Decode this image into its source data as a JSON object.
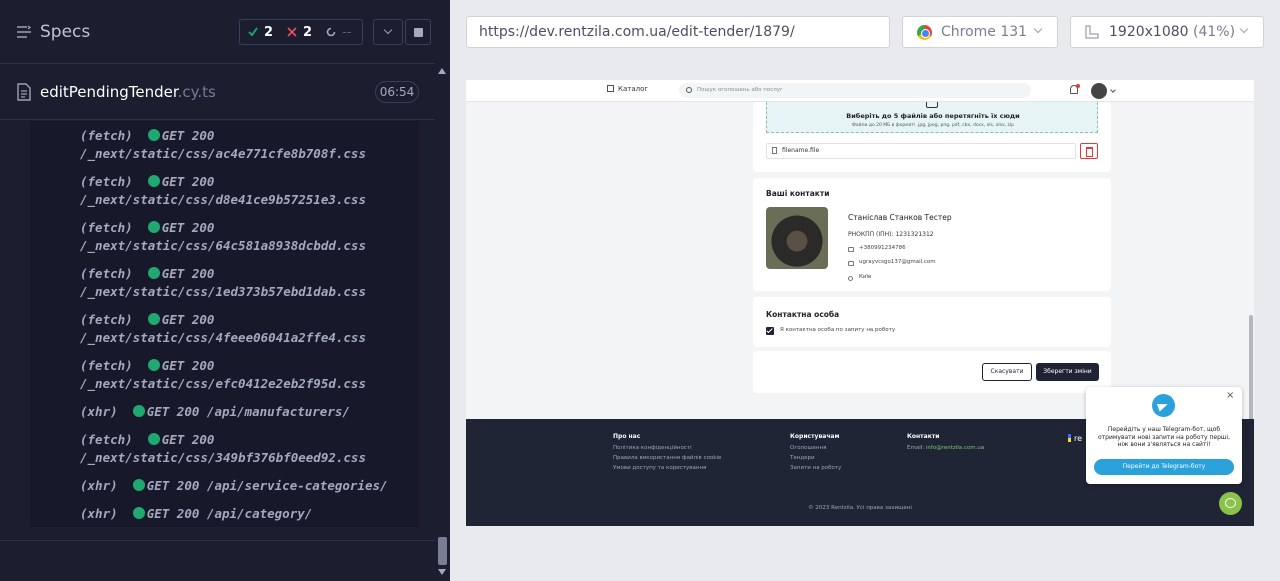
{
  "runner": {
    "title": "Specs",
    "passed": "2",
    "failed": "2",
    "pending": "--",
    "spec": {
      "name": "editPendingTender",
      "ext": ".cy.ts",
      "duration": "06:54"
    },
    "log": [
      {
        "type": "(fetch)",
        "status": "GET 200",
        "path": "/_next/static/css/ac4e771cfe8b708f.css"
      },
      {
        "type": "(fetch)",
        "status": "GET 200",
        "path": "/_next/static/css/d8e41ce9b57251e3.css"
      },
      {
        "type": "(fetch)",
        "status": "GET 200",
        "path": "/_next/static/css/64c581a8938dcbdd.css"
      },
      {
        "type": "(fetch)",
        "status": "GET 200",
        "path": "/_next/static/css/1ed373b57ebd1dab.css"
      },
      {
        "type": "(fetch)",
        "status": "GET 200",
        "path": "/_next/static/css/4feee06041a2ffe4.css"
      },
      {
        "type": "(fetch)",
        "status": "GET 200",
        "path": "/_next/static/css/efc0412e2eb2f95d.css"
      },
      {
        "type": "(xhr)",
        "status": "GET 200",
        "path": "/api/manufacturers/"
      },
      {
        "type": "(fetch)",
        "status": "GET 200",
        "path": "/_next/static/css/349bf376bf0eed92.css"
      },
      {
        "type": "(xhr)",
        "status": "GET 200",
        "path": "/api/service-categories/"
      },
      {
        "type": "(xhr)",
        "status": "GET 200",
        "path": "/api/category/"
      }
    ]
  },
  "browser": {
    "url": "https://dev.rentzila.com.ua/edit-tender/1879/",
    "name": "Chrome 131",
    "viewport": "1920x1080",
    "scale": "(41%)"
  },
  "app": {
    "header": {
      "catalog": "Каталог",
      "search_placeholder": "Пошук оголошень або послуг"
    },
    "upload": {
      "title": "Виберіть до 5 файлів або перетягніть їх сюди",
      "hint": "Файли до 20 МБ в форматі .jpg, jpeg, png, pdf, cbx, docx, xls, xlsx, zip",
      "file_name": "filename.file"
    },
    "contacts": {
      "title": "Ваші контакти",
      "name": "Станіслав Станков Тестер",
      "inn": "РНОКПП (ІПН): 1231321312",
      "phone": "+380991234786",
      "email": "ugrayvcsgo137@gmail.com",
      "city": "Київ"
    },
    "contact_person": {
      "title": "Контактна особа",
      "checkbox_label": "Я контактна особа по запиту на роботу",
      "checked": true
    },
    "actions": {
      "cancel": "Скасувати",
      "save": "Зберегти зміни"
    },
    "footer": {
      "about_head": "Про нас",
      "about_links": [
        "Політика конфіденційності",
        "Правила використання файлів cookie",
        "Умови доступу та користування"
      ],
      "users_head": "Користувачам",
      "users_links": [
        "Оголошення",
        "Тендери",
        "Запити на роботу"
      ],
      "contacts_head": "Контакти",
      "email_label": "Email:",
      "email": "info@rentzila.com.ua",
      "logo": "re",
      "copyright": "© 2023 Rentzila. Усі права захищені"
    },
    "telegram": {
      "text": "Перейдіть у наш Telegram-бот, щоб отримувати нові запити на роботу перші, ніж вони з'являться на сайті!",
      "button": "Перейти до Telegram-боту"
    }
  },
  "colors": {
    "panel_bg": "#1b1e2e",
    "pass": "#1fa971",
    "fail": "#e94f5f",
    "primary_dark": "#1e2336",
    "telegram": "#2aa1da"
  }
}
